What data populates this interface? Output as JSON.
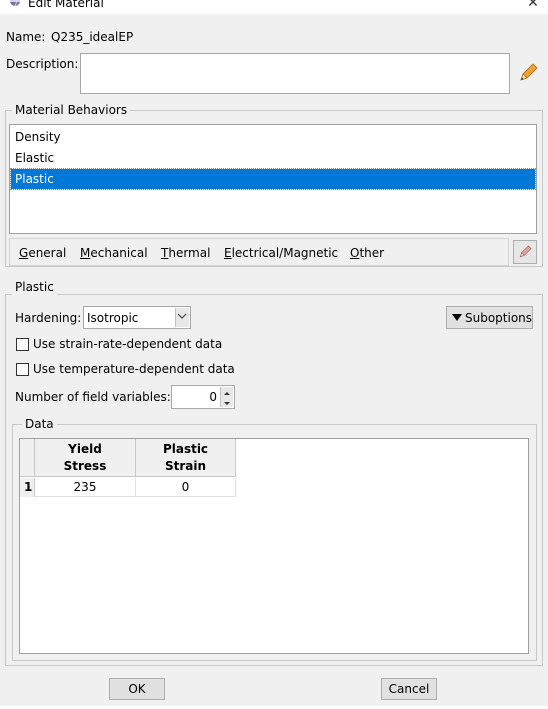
{
  "window": {
    "title": "Edit Material",
    "close_glyph": "✕"
  },
  "material": {
    "name_label": "Name:",
    "name_value": "Q235_idealEP",
    "description_label": "Description:",
    "description_value": ""
  },
  "material_behaviors": {
    "title": "Material Behaviors",
    "items": [
      {
        "label": "Density",
        "selected": false
      },
      {
        "label": "Elastic",
        "selected": false
      },
      {
        "label": "Plastic",
        "selected": true
      }
    ],
    "menu": [
      {
        "label": "General",
        "underline": "G",
        "rest": "eneral"
      },
      {
        "label": "Mechanical",
        "underline": "M",
        "rest": "echanical"
      },
      {
        "label": "Thermal",
        "underline": "T",
        "rest": "hermal"
      },
      {
        "label": "Electrical/Magnetic",
        "underline": "E",
        "rest": "lectrical/Magnetic"
      },
      {
        "label": "Other",
        "underline": "O",
        "rest": "ther"
      }
    ]
  },
  "plastic": {
    "title": "Plastic",
    "hardening_label": "Hardening:",
    "hardening_value": "Isotropic",
    "suboptions_label": "Suboptions",
    "strain_rate_label": "Use strain-rate-dependent data",
    "strain_rate_checked": false,
    "temperature_label": "Use temperature-dependent data",
    "temperature_checked": false,
    "field_vars_label": "Number of field variables:",
    "field_vars_value": "0"
  },
  "data": {
    "title": "Data",
    "columns": [
      {
        "line1": "Yield",
        "line2": "Stress"
      },
      {
        "line1": "Plastic",
        "line2": "Strain"
      }
    ],
    "rows": [
      {
        "index": "1",
        "cells": [
          "235",
          "0"
        ]
      }
    ]
  },
  "buttons": {
    "ok": "OK",
    "cancel": "Cancel"
  },
  "colors": {
    "selection": "#0078d7",
    "pencil": "#f0a030",
    "dialog_bg": "#f0f0f0"
  },
  "icons": {
    "title": "abaqus-material-icon",
    "edit": "pencil-icon",
    "dropdown": "chevron-down-icon"
  }
}
